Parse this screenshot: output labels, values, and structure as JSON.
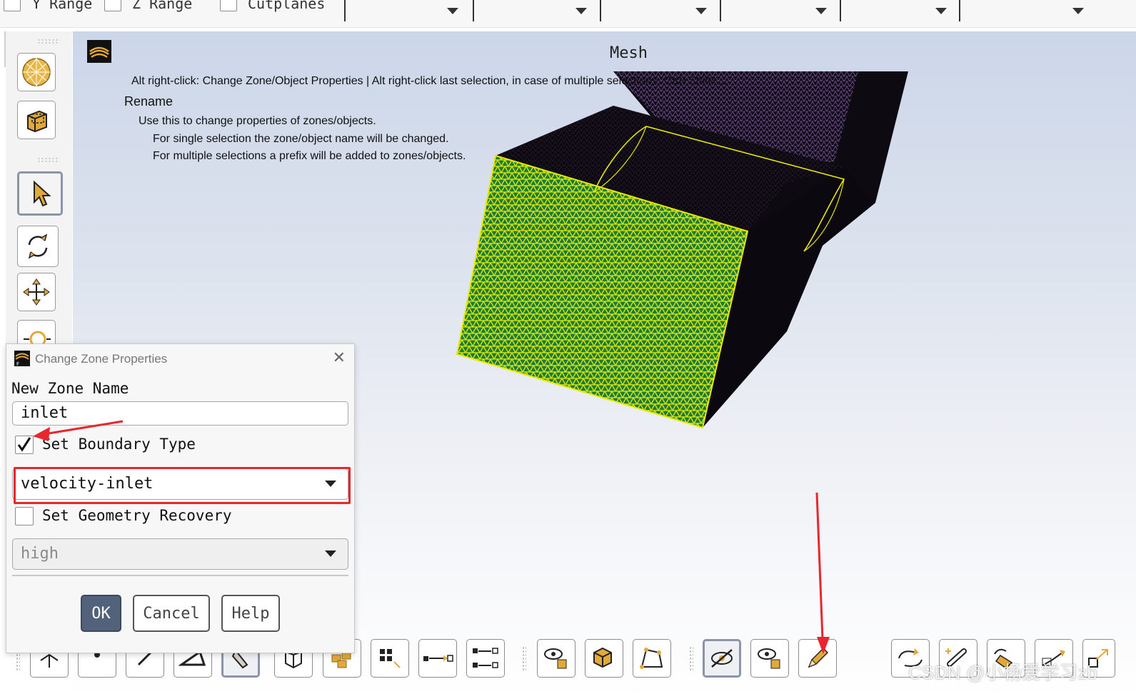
{
  "top_bar": {
    "y_range_label": "Y Range",
    "z_range_label": "Z Range",
    "cutplanes_label": "Cutplanes"
  },
  "viewport": {
    "title": "Mesh",
    "hint_line": "Alt right-click: Change Zone/Object Properties | Alt right-click last selection, in case of multiple selections. Ctrl+Shift+...",
    "hint_heading": "Rename",
    "hint_desc": "Use this to change properties of zones/objects.",
    "hint_single": "For single selection the zone/object name will be changed.",
    "hint_multi": "For multiple selections a prefix will be added to zones/objects.",
    "colors": {
      "selected_face": "#c8d80a",
      "wire_highlight": "#e8e800",
      "body": "#0f0a14",
      "top_mesh": "#6f4d8c"
    }
  },
  "dialog": {
    "title": "Change Zone Properties",
    "new_zone_name_label": "New Zone Name",
    "new_zone_name_value": "inlet",
    "set_boundary_type_label": "Set Boundary Type",
    "set_boundary_type_checked": true,
    "boundary_type_value": "velocity-inlet",
    "set_geometry_recovery_label": "Set Geometry Recovery",
    "set_geometry_recovery_checked": false,
    "geometry_recovery_value": "high",
    "ok_label": "OK",
    "cancel_label": "Cancel",
    "help_label": "Help"
  },
  "annotation_color": "#e8262d",
  "watermark": "CSDN @小杨爱学习zb"
}
